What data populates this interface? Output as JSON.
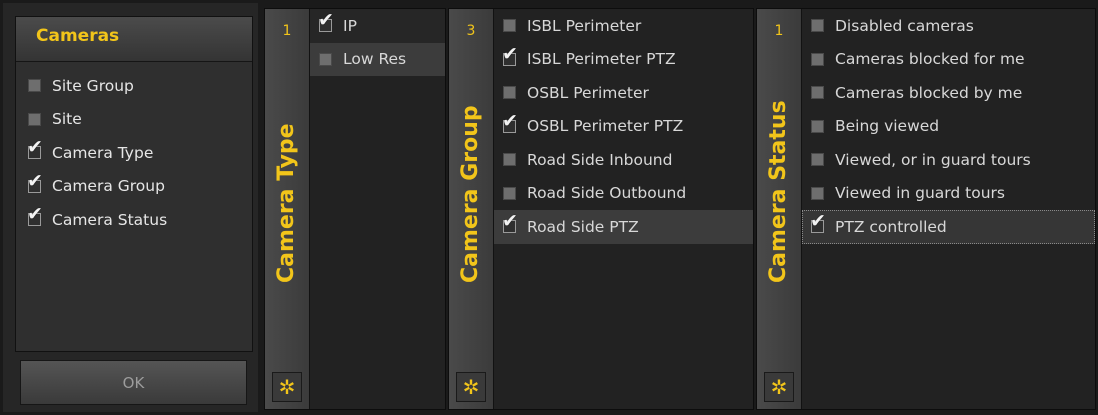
{
  "cameras_panel": {
    "title": "Cameras",
    "items": [
      {
        "label": "Site Group",
        "checked": false
      },
      {
        "label": "Site",
        "checked": false
      },
      {
        "label": "Camera Type",
        "checked": true
      },
      {
        "label": "Camera Group",
        "checked": true
      },
      {
        "label": "Camera Status",
        "checked": true
      }
    ],
    "ok_label": "OK"
  },
  "camera_type": {
    "title": "Camera Type",
    "count": "1",
    "items": [
      {
        "label": "IP",
        "checked": true
      },
      {
        "label": "Low Res",
        "checked": false
      }
    ]
  },
  "camera_group": {
    "title": "Camera Group",
    "count": "3",
    "items": [
      {
        "label": "ISBL Perimeter",
        "checked": false
      },
      {
        "label": "ISBL Perimeter PTZ",
        "checked": true
      },
      {
        "label": "OSBL Perimeter",
        "checked": false
      },
      {
        "label": "OSBL Perimeter PTZ",
        "checked": true
      },
      {
        "label": "Road Side Inbound",
        "checked": false
      },
      {
        "label": "Road Side Outbound",
        "checked": false
      },
      {
        "label": "Road Side PTZ",
        "checked": true
      }
    ]
  },
  "camera_status": {
    "title": "Camera Status",
    "count": "1",
    "items": [
      {
        "label": "Disabled cameras",
        "checked": false
      },
      {
        "label": "Cameras blocked for me",
        "checked": false
      },
      {
        "label": "Cameras blocked by me",
        "checked": false
      },
      {
        "label": "Being viewed",
        "checked": false
      },
      {
        "label": "Viewed, or in guard tours",
        "checked": false
      },
      {
        "label": "Viewed in guard tours",
        "checked": false
      },
      {
        "label": "PTZ controlled",
        "checked": true
      }
    ]
  },
  "icons": {
    "checkmark": "checkmark-icon",
    "clear_filter": "sparkle-clear-icon"
  },
  "colors": {
    "accent": "#f2c51a",
    "background": "#1a1a1a"
  }
}
